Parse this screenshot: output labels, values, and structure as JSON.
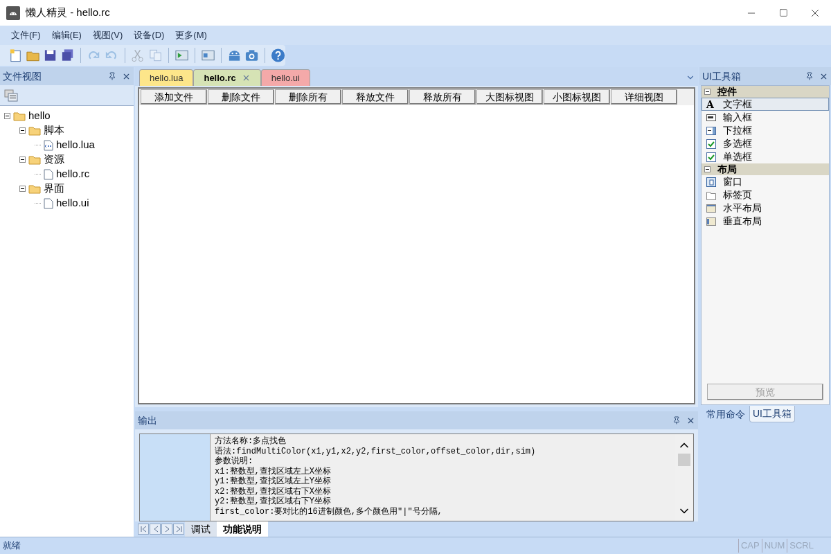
{
  "window": {
    "title": "懒人精灵 - hello.rc"
  },
  "menu": [
    "文件(F)",
    "编辑(E)",
    "视图(V)",
    "设备(D)",
    "更多(M)"
  ],
  "toolbar": [
    {
      "kind": "new",
      "disabled": false
    },
    {
      "kind": "open",
      "disabled": false
    },
    {
      "kind": "save",
      "disabled": false
    },
    {
      "kind": "saveall",
      "disabled": false
    },
    {
      "kind": "sep"
    },
    {
      "kind": "redo",
      "disabled": true
    },
    {
      "kind": "undo",
      "disabled": true
    },
    {
      "kind": "sep"
    },
    {
      "kind": "cut",
      "disabled": true
    },
    {
      "kind": "copy",
      "disabled": true
    },
    {
      "kind": "sep"
    },
    {
      "kind": "run",
      "disabled": false
    },
    {
      "kind": "sep"
    },
    {
      "kind": "panel",
      "disabled": false
    },
    {
      "kind": "sep"
    },
    {
      "kind": "robot",
      "disabled": false
    },
    {
      "kind": "camera",
      "disabled": false
    },
    {
      "kind": "sep"
    },
    {
      "kind": "help",
      "disabled": false
    }
  ],
  "file_view": {
    "title": "文件视图",
    "tree": [
      {
        "label": "hello",
        "kind": "folder",
        "expanded": true,
        "children": [
          {
            "label": "脚本",
            "kind": "folder",
            "expanded": true,
            "children": [
              {
                "label": "hello.lua",
                "kind": "script"
              }
            ]
          },
          {
            "label": "资源",
            "kind": "folder",
            "expanded": true,
            "children": [
              {
                "label": "hello.rc",
                "kind": "file"
              }
            ]
          },
          {
            "label": "界面",
            "kind": "folder",
            "expanded": true,
            "children": [
              {
                "label": "hello.ui",
                "kind": "file"
              }
            ]
          }
        ]
      }
    ]
  },
  "doc_tabs": [
    {
      "label": "hello.lua",
      "selected": false,
      "color": "#fde68a"
    },
    {
      "label": "hello.rc",
      "selected": true,
      "color": "#d6e3b5"
    },
    {
      "label": "hello.ui",
      "selected": false,
      "color": "#f4a9a9"
    }
  ],
  "resource_buttons": [
    "添加文件",
    "删除文件",
    "删除所有",
    "释放文件",
    "释放所有",
    "大图标视图",
    "小图标视图",
    "详细视图"
  ],
  "toolbox": {
    "title": "UI工具箱",
    "groups": [
      {
        "label": "控件",
        "expanded": true,
        "items": [
          {
            "label": "文字框",
            "kind": "text",
            "icon": "A",
            "selected": true
          },
          {
            "label": "输入框",
            "kind": "input",
            "selected": false
          },
          {
            "label": "下拉框",
            "kind": "combo",
            "selected": false
          },
          {
            "label": "多选框",
            "kind": "check",
            "selected": false
          },
          {
            "label": "单选框",
            "kind": "check",
            "selected": false
          }
        ]
      },
      {
        "label": "布局",
        "expanded": true,
        "items": [
          {
            "label": "窗口",
            "kind": "window",
            "selected": false
          },
          {
            "label": "标签页",
            "kind": "tabpage",
            "selected": false
          },
          {
            "label": "水平布局",
            "kind": "hlayout",
            "selected": false
          },
          {
            "label": "垂直布局",
            "kind": "vlayout",
            "selected": false
          }
        ]
      }
    ],
    "preview_button": {
      "label": "预览",
      "disabled": true
    },
    "tabs": [
      {
        "label": "常用命令",
        "selected": false
      },
      {
        "label": "UI工具箱",
        "selected": true
      }
    ]
  },
  "output": {
    "title": "输出",
    "lines": [
      "方法名称:多点找色",
      "语法:findMultiColor(x1,y1,x2,y2,first_color,offset_color,dir,sim)",
      "参数说明:",
      "x1:整数型,查找区域左上X坐标",
      "y1:整数型,查找区域左上Y坐标",
      "x2:整数型,查找区域右下X坐标",
      "y2:整数型,查找区域右下Y坐标",
      "first_color:要对比的16进制颜色,多个颜色用\"|\"号分隔,"
    ],
    "tabs": [
      {
        "label": "调试",
        "selected": false
      },
      {
        "label": "功能说明",
        "selected": true
      }
    ]
  },
  "status_bar": {
    "text": "就绪",
    "indicators": [
      "CAP",
      "NUM",
      "SCRL"
    ]
  }
}
